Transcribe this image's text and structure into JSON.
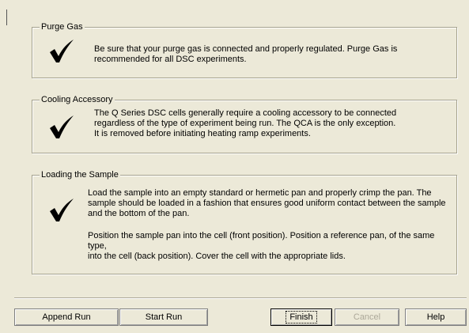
{
  "groups": {
    "purge": {
      "title": "Purge Gas",
      "lines": [
        "Be sure that your purge gas is connected and properly regulated.  Purge Gas is",
        "recommended for all DSC experiments."
      ]
    },
    "cooling": {
      "title": "Cooling Accessory",
      "lines": [
        "The Q Series DSC cells generally require a cooling accessory to be connected",
        "regardless of the type of experiment being run.  The QCA is the only exception.",
        "It is removed before initiating heating ramp experiments."
      ]
    },
    "loading": {
      "title": "Loading the Sample",
      "para1": [
        "Load the sample into an empty standard or hermetic pan and properly crimp the pan. The",
        "sample should be loaded in a fashion that ensures good uniform contact between the sample",
        "and the bottom of the pan."
      ],
      "para2": [
        "Position the sample pan into the cell (front position). Position a reference pan, of the same type,",
        "into the cell (back position). Cover the cell with the appropriate lids."
      ]
    }
  },
  "buttons": {
    "append_run": "Append Run",
    "start_run": "Start Run",
    "finish": "Finish",
    "cancel": "Cancel",
    "help": "Help"
  }
}
